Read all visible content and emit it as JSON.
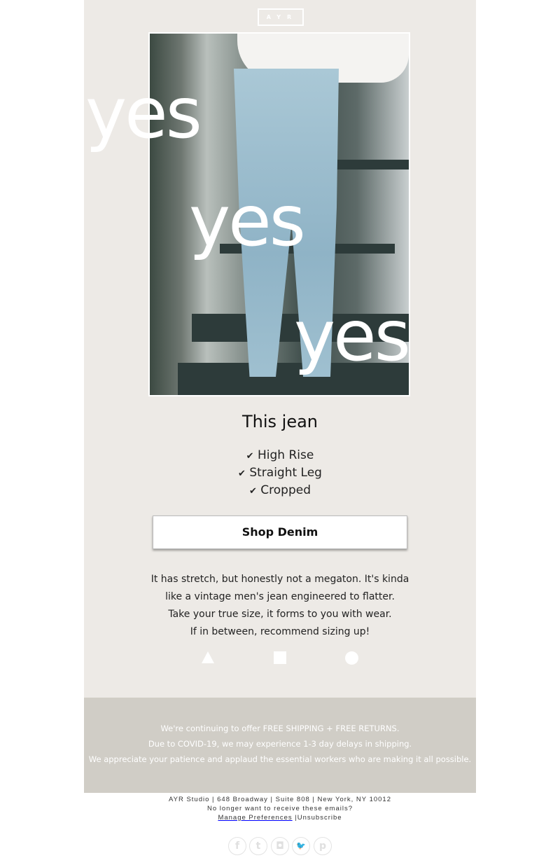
{
  "logo": "AYR",
  "hero": {
    "overlay_words": [
      "yes",
      "yes",
      "yes"
    ]
  },
  "title": "This jean",
  "features": [
    "High Rise",
    "Straight Leg",
    "Cropped"
  ],
  "check_icon": "✔",
  "cta": "Shop Denim",
  "description": [
    "It has stretch, but honestly not a megaton. It's kinda",
    "like a vintage men's jean engineered to flatter.",
    "Take your true size, it forms to you with wear.",
    "If in between, recommend sizing up!"
  ],
  "shapes": [
    "triangle",
    "square",
    "circle"
  ],
  "banner": [
    "We're continuing to offer FREE SHIPPING + FREE RETURNS.",
    "Due to COVID-19, we may experience 1-3 day delays in shipping.",
    "We appreciate your patience and applaud the essential workers who are making it all possible."
  ],
  "footer": {
    "address": "AYR Studio | 648 Broadway | Suite 808 | New York, NY 10012",
    "question": "No longer want to receive these emails?",
    "manage": "Manage Preferences",
    "sep": " |",
    "unsubscribe": "Unsubscribe"
  },
  "social": [
    {
      "name": "facebook",
      "glyph": "f"
    },
    {
      "name": "tumblr",
      "glyph": "t"
    },
    {
      "name": "instagram",
      "glyph": "◘"
    },
    {
      "name": "twitter",
      "glyph": "🐦"
    },
    {
      "name": "pinterest",
      "glyph": "p"
    }
  ],
  "colors": {
    "background": "#edeae6",
    "banner": "#d0cdc6"
  }
}
